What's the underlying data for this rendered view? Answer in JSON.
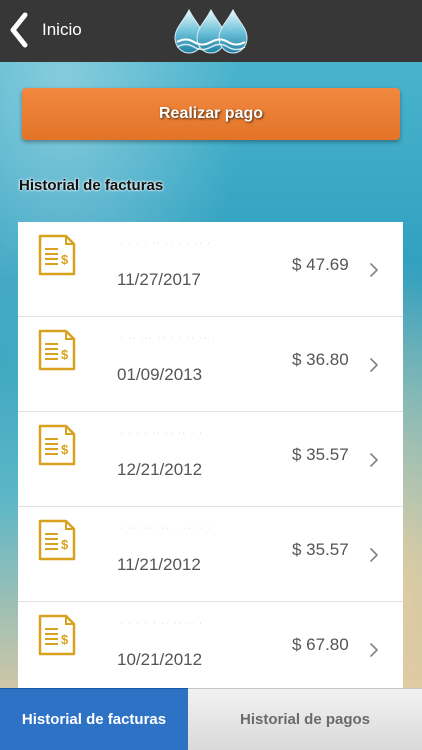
{
  "header": {
    "back_label": "Inicio",
    "back_icon": "chevron-left-icon",
    "logo_icon": "water-drops-logo"
  },
  "actions": {
    "pay_label": "Realizar pago"
  },
  "history": {
    "title": "Historial de facturas",
    "items": [
      {
        "account": "· · · · ·· ·· · · ·· ·",
        "date": "11/27/2017",
        "amount": "$ 47.69"
      },
      {
        "account": "· ·· ··· ·· · · ·· ·· ·",
        "date": "01/09/2013",
        "amount": "$ 36.80"
      },
      {
        "account": "· · · · ·· ·· ·· · ·",
        "date": "12/21/2012",
        "amount": "$ 35.57"
      },
      {
        "account": "· ·· ···· ·· · ·· ·· ·",
        "date": "11/21/2012",
        "amount": "$ 35.57"
      },
      {
        "account": "· · · · · ·· ·· ·· ·",
        "date": "10/21/2012",
        "amount": "$ 67.80"
      }
    ]
  },
  "tabs": [
    {
      "label": "Historial de facturas",
      "active": true
    },
    {
      "label": "Historial de pagos",
      "active": false
    }
  ],
  "colors": {
    "accent_orange": "#e37427",
    "tab_active": "#2e72c5",
    "icon_gold": "#d9a21e",
    "topbar": "#373737"
  }
}
